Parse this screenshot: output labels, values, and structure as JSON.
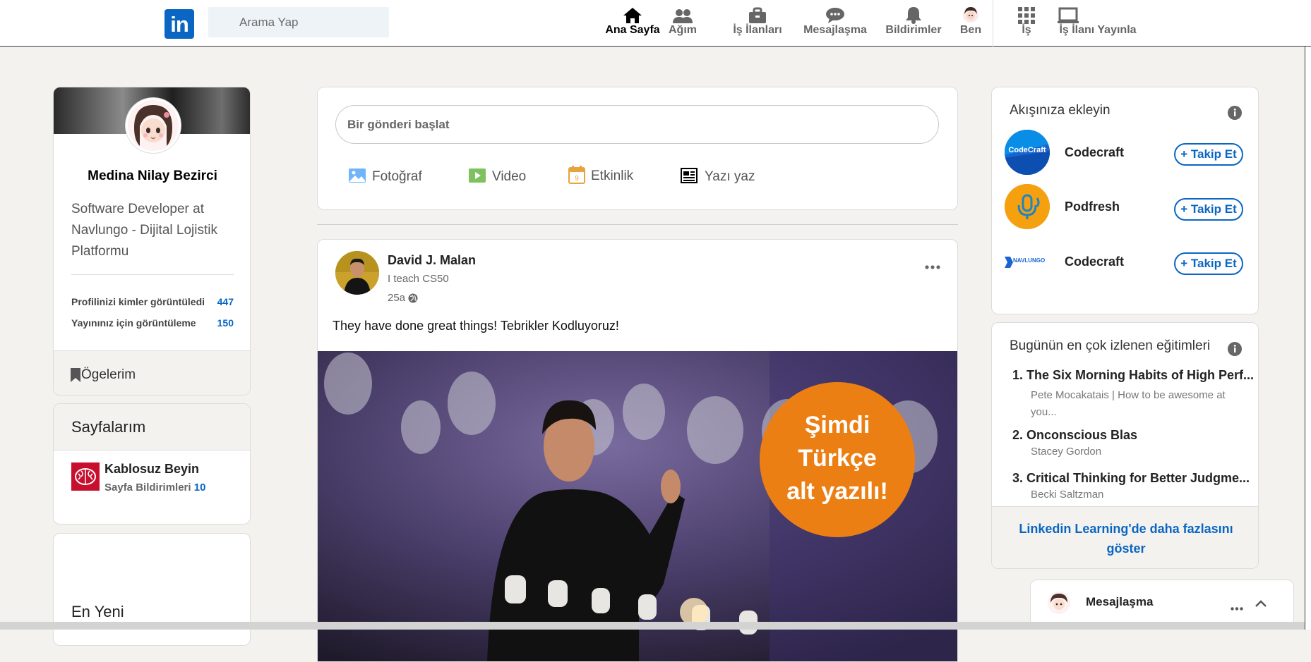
{
  "header": {
    "logo_text": "in",
    "search_placeholder": "Arama Yap",
    "nav": [
      {
        "label": "Ana Sayfa",
        "icon": "home-icon",
        "active": true
      },
      {
        "label": "Ağım",
        "icon": "network-icon"
      },
      {
        "label": "İş İlanları",
        "icon": "briefcase-icon"
      },
      {
        "label": "Mesajlaşma",
        "icon": "messaging-icon"
      },
      {
        "label": "Bildirimler",
        "icon": "bell-icon"
      },
      {
        "label": "Ben",
        "icon": "avatar"
      },
      {
        "label": "İş",
        "icon": "grid-icon"
      },
      {
        "label": "İş İlanı Yayınla",
        "icon": "post-job-icon"
      }
    ]
  },
  "profile": {
    "name": "Medina Nilay Bezirci",
    "headline": "Software Developer at Navlungo - Dijital Lojistik Platformu",
    "stats": [
      {
        "label": "Profilinizi kimler görüntüledi",
        "value": "447"
      },
      {
        "label": "Yayınınız için görüntüleme",
        "value": "150"
      }
    ],
    "saved_items_label": "Ögelerim"
  },
  "pages": {
    "title": "Sayfalarım",
    "items": [
      {
        "name": "Kablosuz Beyin",
        "notif_label": "Sayfa Bildirimleri",
        "notif_count": "10"
      }
    ]
  },
  "recent": {
    "title": "En Yeni"
  },
  "composer": {
    "placeholder": "Bir gönderi başlat",
    "actions": [
      {
        "label": "Fotoğraf",
        "icon": "photo-icon",
        "color": "#70b5f9"
      },
      {
        "label": "Video",
        "icon": "video-icon",
        "color": "#7fc15e"
      },
      {
        "label": "Etkinlik",
        "icon": "calendar-icon",
        "color": "#e7a33e"
      },
      {
        "label": "Yazı yaz",
        "icon": "article-icon",
        "color": "#000000"
      }
    ]
  },
  "post": {
    "author": "David J. Malan",
    "subtitle": "I teach CS50",
    "time": "25a",
    "text": "They have done great things! Tebrikler Kodluyoruz!",
    "image_badge": [
      "Şimdi",
      "Türkçe",
      "alt yazılı!"
    ]
  },
  "suggestions": {
    "title": "Akışınıza ekleyin",
    "follow_label": "+ Takip Et",
    "items": [
      {
        "name": "Codecraft",
        "logo_text": "CodeCraft"
      },
      {
        "name": "Podfresh",
        "logo_text": ""
      },
      {
        "name": "Codecraft",
        "logo_text": "NAVLUNGO"
      }
    ]
  },
  "learning": {
    "title": "Bugünün en çok izlenen eğitimleri",
    "courses": [
      {
        "title": "1. The Six Morning Habits of High Perf...",
        "author": "Pete Mocakatais | How to be awesome at you..."
      },
      {
        "title": "2. Onconscious Blas",
        "author": "Stacey Gordon"
      },
      {
        "title": "3. Critical Thinking for Better Judgme...",
        "author": "Becki Saltzman"
      }
    ],
    "more_link": "Linkedin Learning'de daha fazlasını göster"
  },
  "messaging": {
    "label": "Mesajlaşma"
  }
}
